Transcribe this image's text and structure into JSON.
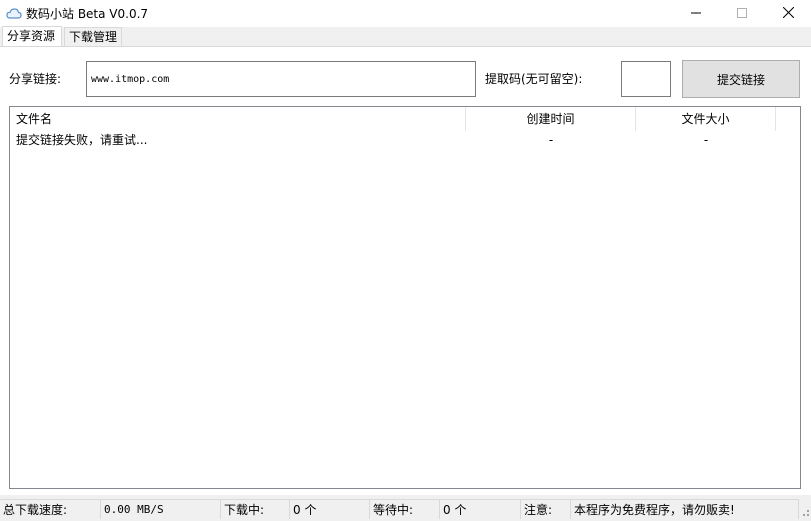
{
  "window": {
    "title": "数码小站 Beta V0.0.7",
    "icon": "cloud-icon",
    "controls": {
      "minimize": "—",
      "maximize": "☐",
      "close": "✕"
    }
  },
  "tabs": [
    {
      "label": "分享资源",
      "active": true
    },
    {
      "label": "下载管理",
      "active": false
    }
  ],
  "share_form": {
    "link_label": "分享链接:",
    "link_value": "www.itmop.com",
    "code_label": "提取码(无可留空):",
    "code_value": "",
    "submit_label": "提交链接"
  },
  "list": {
    "columns": [
      "文件名",
      "创建时间",
      "文件大小"
    ],
    "rows": [
      {
        "name": "提交链接失败，请重试...",
        "time": "-",
        "size": "-"
      }
    ]
  },
  "status": {
    "speed_label": "总下载速度:",
    "speed_value": "0.00 MB/S",
    "downloading_label": "下载中:",
    "downloading_value": "0 个",
    "waiting_label": "等待中:",
    "waiting_value": "0 个",
    "notice_label": "注意:",
    "notice_value": "本程序为免费程序，请勿贩卖!"
  },
  "colors": {
    "window_bg": "#f0f0f0",
    "panel_bg": "#ffffff",
    "button_bg": "#e1e1e1",
    "border": "#828790"
  }
}
